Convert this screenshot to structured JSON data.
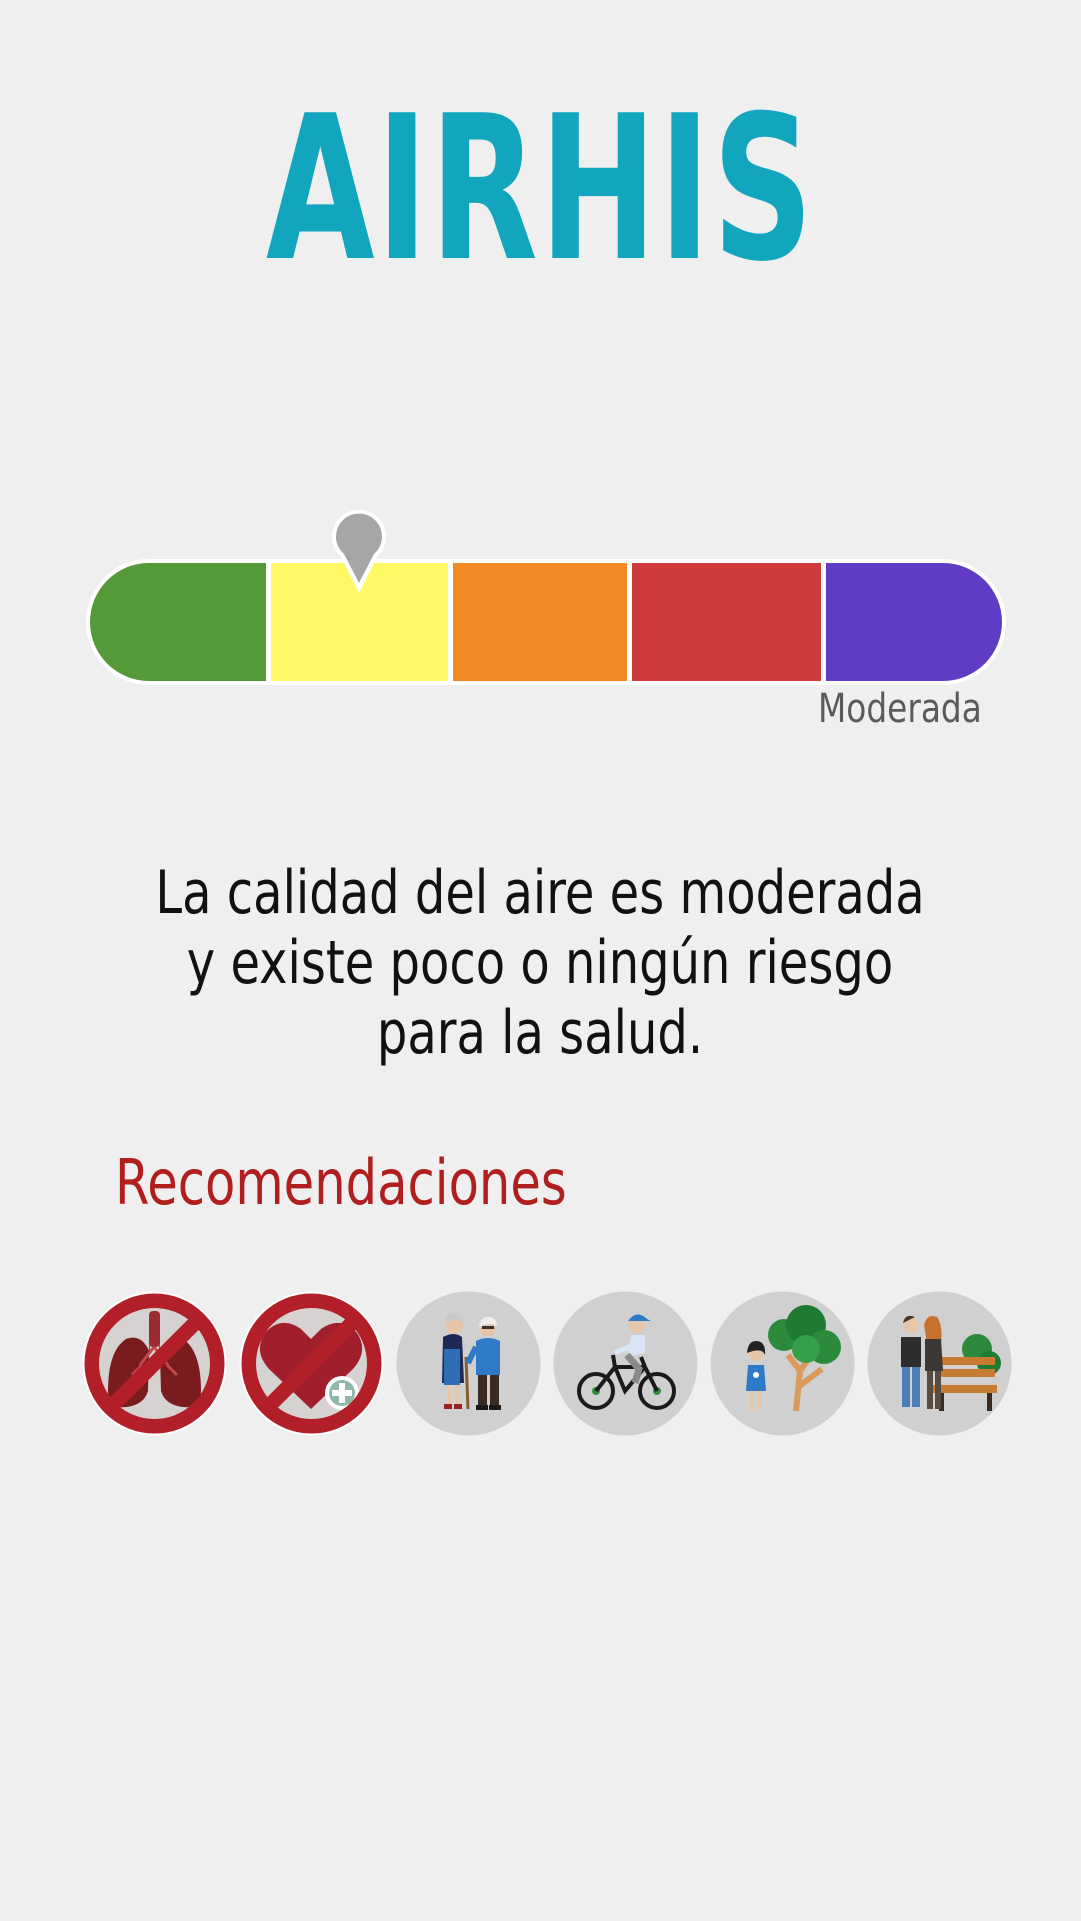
{
  "app": {
    "title": "AIRHIS"
  },
  "air_quality": {
    "level_label": "Moderada",
    "level_index": 1,
    "levels": [
      {
        "color": "#549a39"
      },
      {
        "color": "#fef964"
      },
      {
        "color": "#f28a25"
      },
      {
        "color": "#cf3a3a"
      },
      {
        "color": "#5f3cc3"
      }
    ],
    "marker_color": "#a6a6a6",
    "description": "La calidad del aire es moderada y existe poco o ningún riesgo para la salud."
  },
  "recommendations": {
    "title": "Recomendaciones",
    "items": [
      {
        "icon": "no-lungs-icon"
      },
      {
        "icon": "no-heart-icon"
      },
      {
        "icon": "elderly-couple-icon"
      },
      {
        "icon": "cyclist-icon"
      },
      {
        "icon": "child-trees-icon"
      },
      {
        "icon": "couple-bench-icon"
      }
    ]
  },
  "colors": {
    "title": "#12a6be",
    "recommendations_title": "#b01e1e",
    "background": "#efefef",
    "prohibition_red": "#b31f28",
    "icon_circle": "#d1d0d0"
  }
}
